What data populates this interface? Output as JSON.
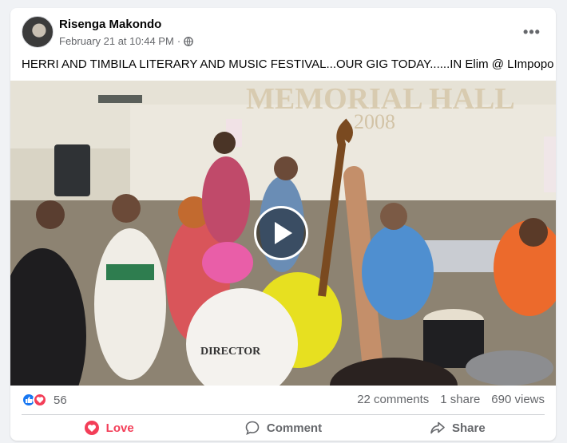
{
  "post": {
    "author": "Risenga Makondo",
    "timestamp": "February 21 at 10:44 PM",
    "separator": "·",
    "privacy_icon": "globe-icon",
    "more_icon": "more-options-icon",
    "text": "HERRI AND TIMBILA LITERARY AND MUSIC FESTIVAL...OUR GIG TODAY......IN Elim @ LImpopo"
  },
  "video": {
    "sign_line1": "MEMORIAL HALL",
    "sign_line2": "2008",
    "shirt_text": "DIRECTOR",
    "play_icon": "play-icon"
  },
  "stats": {
    "reaction_icons": [
      "like-icon",
      "love-icon"
    ],
    "reaction_count": "56",
    "comments": "22 comments",
    "shares": "1 share",
    "views": "690 views"
  },
  "actions": {
    "love_label": "Love",
    "comment_label": "Comment",
    "share_label": "Share"
  },
  "colors": {
    "accent_blue": "#1877f2",
    "love_red": "#f33e58",
    "secondary_text": "#65676b"
  }
}
